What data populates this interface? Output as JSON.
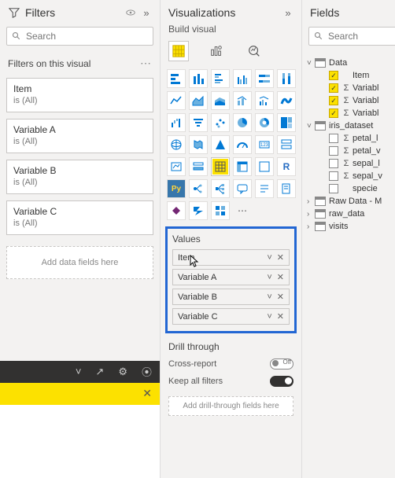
{
  "filters": {
    "title": "Filters",
    "search_placeholder": "Search",
    "section": "Filters on this visual",
    "cards": [
      {
        "name": "Item",
        "sub": "is (All)"
      },
      {
        "name": "Variable A",
        "sub": "is (All)"
      },
      {
        "name": "Variable B",
        "sub": "is (All)"
      },
      {
        "name": "Variable C",
        "sub": "is (All)"
      }
    ],
    "add_hint": "Add data fields here"
  },
  "vis": {
    "title": "Visualizations",
    "subtitle": "Build visual",
    "values_label": "Values",
    "values": [
      {
        "label": "Item"
      },
      {
        "label": "Variable A"
      },
      {
        "label": "Variable B"
      },
      {
        "label": "Variable C"
      }
    ],
    "drill_label": "Drill through",
    "cross_label": "Cross-report",
    "cross_state": "Off",
    "keep_label": "Keep all filters",
    "keep_state": "On",
    "drill_hint": "Add drill-through fields here",
    "gallery": [
      "stacked-bar",
      "stacked-column",
      "clustered-bar",
      "clustered-column",
      "100-bar",
      "100-column",
      "line",
      "area",
      "stacked-area",
      "line-stacked",
      "line-clustered",
      "ribbon",
      "waterfall",
      "funnel",
      "scatter",
      "pie",
      "donut",
      "treemap",
      "map",
      "filled-map",
      "azure-map",
      "gauge",
      "card",
      "multi-row",
      "kpi",
      "slicer",
      "table",
      "matrix",
      "r-visual",
      "r",
      "py",
      "key-influencers",
      "decomp-tree",
      "qa",
      "narrative",
      "paginated",
      "powerapps",
      "powerautomate",
      "get-more",
      "more"
    ]
  },
  "fields": {
    "title": "Fields",
    "search_placeholder": "Search",
    "tables": [
      {
        "name": "Data",
        "expanded": true,
        "cols": [
          {
            "name": "Item",
            "checked": true,
            "sigma": false
          },
          {
            "name": "Variable A",
            "checked": true,
            "sigma": true,
            "clip": "Variabl"
          },
          {
            "name": "Variable B",
            "checked": true,
            "sigma": true,
            "clip": "Variabl"
          },
          {
            "name": "Variable C",
            "checked": true,
            "sigma": true,
            "clip": "Variabl"
          }
        ]
      },
      {
        "name": "iris_dataset",
        "expanded": true,
        "cols": [
          {
            "name": "petal_length",
            "checked": false,
            "sigma": true,
            "clip": "petal_l"
          },
          {
            "name": "petal_width",
            "checked": false,
            "sigma": true,
            "clip": "petal_v"
          },
          {
            "name": "sepal_length",
            "checked": false,
            "sigma": true,
            "clip": "sepal_l"
          },
          {
            "name": "sepal_width",
            "checked": false,
            "sigma": true,
            "clip": "sepal_v"
          },
          {
            "name": "species",
            "checked": false,
            "sigma": false,
            "clip": "specie"
          }
        ]
      },
      {
        "name": "Raw Data - M",
        "expanded": false,
        "clip": "Raw Data - M"
      },
      {
        "name": "raw_data",
        "expanded": false
      },
      {
        "name": "visits",
        "expanded": false
      }
    ]
  }
}
